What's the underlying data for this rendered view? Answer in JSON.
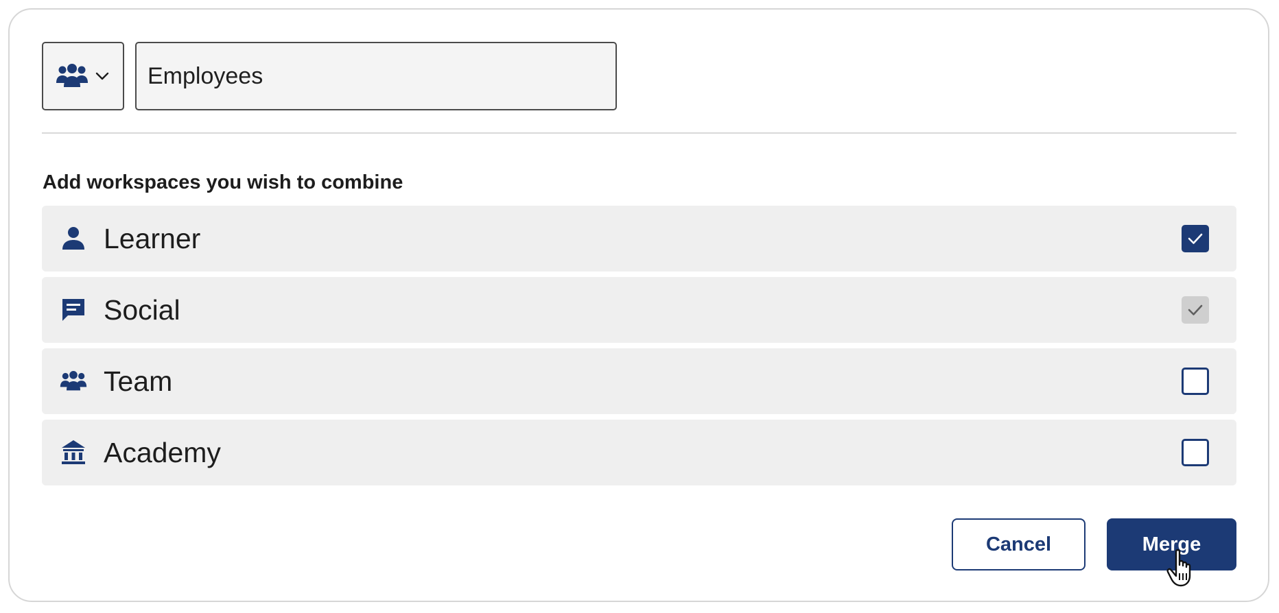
{
  "header": {
    "icon_picker": {
      "selected_icon": "people-group-icon"
    },
    "workspace_name": {
      "value": "Employees"
    }
  },
  "section": {
    "label": "Add workspaces you wish to combine"
  },
  "workspaces": [
    {
      "label": "Learner",
      "icon": "person-icon",
      "state": "checked"
    },
    {
      "label": "Social",
      "icon": "chat-icon",
      "state": "checked-disabled"
    },
    {
      "label": "Team",
      "icon": "people-group-icon",
      "state": "unchecked"
    },
    {
      "label": "Academy",
      "icon": "academy-building-icon",
      "state": "unchecked"
    }
  ],
  "actions": {
    "cancel_label": "Cancel",
    "merge_label": "Merge"
  },
  "colors": {
    "accent": "#1c3a75",
    "row_bg": "#efefef",
    "disabled": "#cfcfcf"
  }
}
